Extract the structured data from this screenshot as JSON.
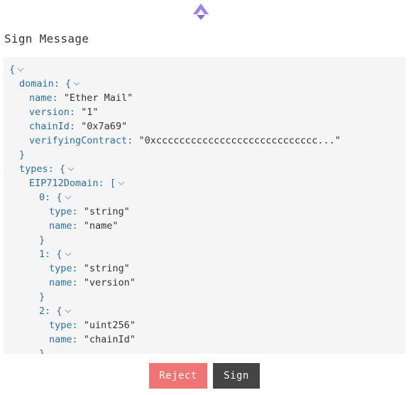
{
  "header": {
    "logo_icon": "stacks-logo-icon",
    "title": "Sign Message"
  },
  "colors": {
    "accent": "#9a79e0",
    "key": "#2c6da3",
    "panel_bg": "#f5f5f5",
    "reject": "#ef7474",
    "sign": "#454545"
  },
  "json_view": {
    "lines": [
      {
        "indent": 0,
        "key": "",
        "open": "{",
        "value": "",
        "chevron": true
      },
      {
        "indent": 1,
        "key": "domain",
        "open": "{",
        "value": "",
        "chevron": true
      },
      {
        "indent": 2,
        "key": "name",
        "open": "",
        "value": "\"Ether Mail\"",
        "chevron": false
      },
      {
        "indent": 2,
        "key": "version",
        "open": "",
        "value": "\"1\"",
        "chevron": false
      },
      {
        "indent": 2,
        "key": "chainId",
        "open": "",
        "value": "\"0x7a69\"",
        "chevron": false
      },
      {
        "indent": 2,
        "key": "verifyingContract",
        "open": "",
        "value": "\"0xcccccccccccccccccccccccccccc...\"",
        "chevron": false
      },
      {
        "indent": 1,
        "key": "",
        "open": "}",
        "value": "",
        "chevron": false
      },
      {
        "indent": 1,
        "key": "types",
        "open": "{",
        "value": "",
        "chevron": true
      },
      {
        "indent": 2,
        "key": "EIP712Domain",
        "open": "[",
        "value": "",
        "chevron": true
      },
      {
        "indent": 3,
        "key": "0",
        "open": "{",
        "value": "",
        "chevron": true
      },
      {
        "indent": 4,
        "key": "type",
        "open": "",
        "value": "\"string\"",
        "chevron": false
      },
      {
        "indent": 4,
        "key": "name",
        "open": "",
        "value": "\"name\"",
        "chevron": false
      },
      {
        "indent": 3,
        "key": "",
        "open": "}",
        "value": "",
        "chevron": false
      },
      {
        "indent": 3,
        "key": "1",
        "open": "{",
        "value": "",
        "chevron": true
      },
      {
        "indent": 4,
        "key": "type",
        "open": "",
        "value": "\"string\"",
        "chevron": false
      },
      {
        "indent": 4,
        "key": "name",
        "open": "",
        "value": "\"version\"",
        "chevron": false
      },
      {
        "indent": 3,
        "key": "",
        "open": "}",
        "value": "",
        "chevron": false
      },
      {
        "indent": 3,
        "key": "2",
        "open": "{",
        "value": "",
        "chevron": true
      },
      {
        "indent": 4,
        "key": "type",
        "open": "",
        "value": "\"uint256\"",
        "chevron": false
      },
      {
        "indent": 4,
        "key": "name",
        "open": "",
        "value": "\"chainId\"",
        "chevron": false
      },
      {
        "indent": 3,
        "key": "",
        "open": "}",
        "value": "",
        "chevron": false
      }
    ]
  },
  "actions": {
    "reject_label": "Reject",
    "sign_label": "Sign"
  }
}
